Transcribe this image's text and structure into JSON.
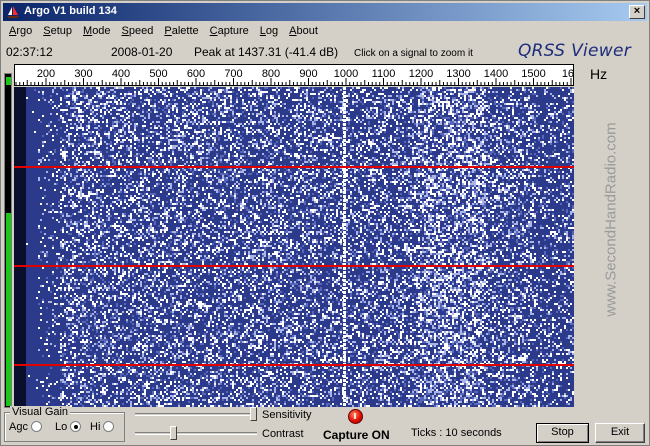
{
  "window": {
    "title": "Argo V1 build 134",
    "close_glyph": "×"
  },
  "menu": [
    {
      "label": "Argo",
      "key": "A"
    },
    {
      "label": "Setup",
      "key": "S"
    },
    {
      "label": "Mode",
      "key": "M"
    },
    {
      "label": "Speed",
      "key": "S"
    },
    {
      "label": "Palette",
      "key": "P"
    },
    {
      "label": "Capture",
      "key": "C"
    },
    {
      "label": "Log",
      "key": "L"
    },
    {
      "label": "About",
      "key": "A"
    }
  ],
  "status": {
    "time": "02:37:12",
    "date": "2008-01-20",
    "peak": "Peak at 1437.31 (-41.4 dB)",
    "hint": "Click on a signal to zoom it",
    "brand": "QRSS Viewer"
  },
  "scale": {
    "labels": [
      "200",
      "300",
      "400",
      "500",
      "600",
      "700",
      "800",
      "900",
      "1000",
      "1100",
      "1200",
      "1300",
      "1400",
      "1500",
      "160"
    ],
    "unit": "Hz"
  },
  "level_meter": {
    "level_fraction": 0.58,
    "color": "#19c819"
  },
  "waterfall": {
    "background_color": "#2b3a8a",
    "marker_color": "#e00000",
    "marker_count": 3,
    "signal_frequency_hz": 1000,
    "side_watermark": "www.SecondHandRadio.com"
  },
  "controls": {
    "gain_title": "Visual Gain",
    "gain_options": [
      {
        "label": "Agc",
        "selected": false
      },
      {
        "label": "Lo",
        "selected": true
      },
      {
        "label": "Hi",
        "selected": false
      }
    ],
    "sensitivity_label": "Sensitivity",
    "sensitivity_value": 1.0,
    "contrast_label": "Contrast",
    "contrast_value": 0.3,
    "capture_text": "Capture ON",
    "capture_led_color": "#e01000",
    "ticks_text": "Ticks  : 10 seconds",
    "stop_label": "Stop",
    "exit_label": "Exit"
  }
}
